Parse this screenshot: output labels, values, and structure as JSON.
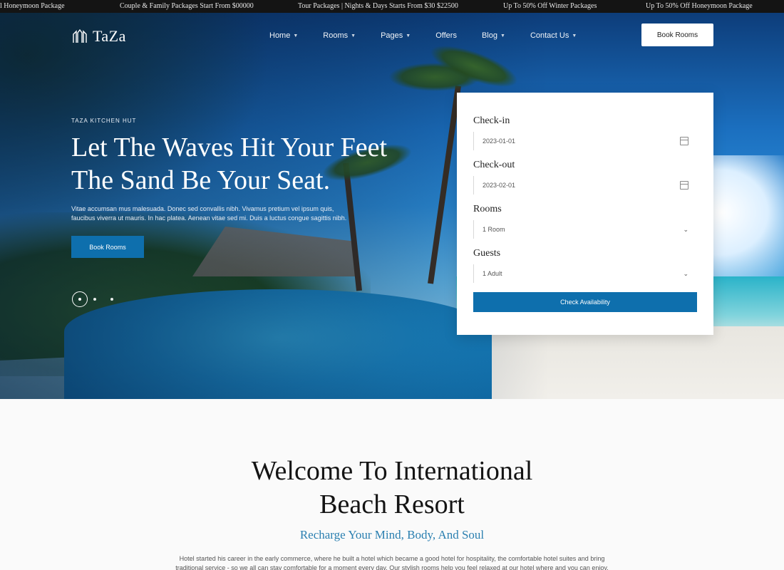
{
  "ticker": {
    "items": [
      "l Honeymoon Package",
      "Couple & Family Packages Start From $00000",
      "Tour Packages | Nights & Days Starts From $30 $22500",
      "Up To 50% Off Winter Packages",
      "Up To 50% Off Honeymoon Package"
    ]
  },
  "brand": {
    "name": "TaZa",
    "accent": "#0e6fad"
  },
  "nav": {
    "items": [
      {
        "label": "Home",
        "dropdown": true
      },
      {
        "label": "Rooms",
        "dropdown": true
      },
      {
        "label": "Pages",
        "dropdown": true
      },
      {
        "label": "Offers",
        "dropdown": false
      },
      {
        "label": "Blog",
        "dropdown": true
      },
      {
        "label": "Contact Us",
        "dropdown": true
      }
    ],
    "cta": "Book Rooms"
  },
  "hero": {
    "eyebrow": "TAZA KITCHEN HUT",
    "headline_line1": "Let The Waves Hit Your Feet",
    "headline_line2": "The Sand Be Your Seat.",
    "description": "Vitae accumsan mus malesuada. Donec sed convallis nibh. Vivamus pretium vel ipsum quis, faucibus viverra ut mauris. In hac platea. Aenean vitae sed mi. Duis a luctus congue sagittis nibh.",
    "button": "Book Rooms",
    "slide_count": 3,
    "active_slide": 1
  },
  "booking": {
    "checkin_label": "Check-in",
    "checkin_value": "2023-01-01",
    "checkout_label": "Check-out",
    "checkout_value": "2023-02-01",
    "rooms_label": "Rooms",
    "rooms_value": "1 Room",
    "guests_label": "Guests",
    "guests_value": "1 Adult",
    "submit": "Check Availability"
  },
  "welcome": {
    "title_line1": "Welcome To International",
    "title_line2": "Beach Resort",
    "subtitle": "Recharge Your Mind, Body, And Soul",
    "body": "Hotel started his career in the early commerce, where he built a hotel which became a good hotel for hospitality, the comfortable hotel suites and bring traditional service - so we all can stay comfortable for a moment every day. Our stylish rooms help you feel relaxed at our hotel where and you can enjoy."
  }
}
